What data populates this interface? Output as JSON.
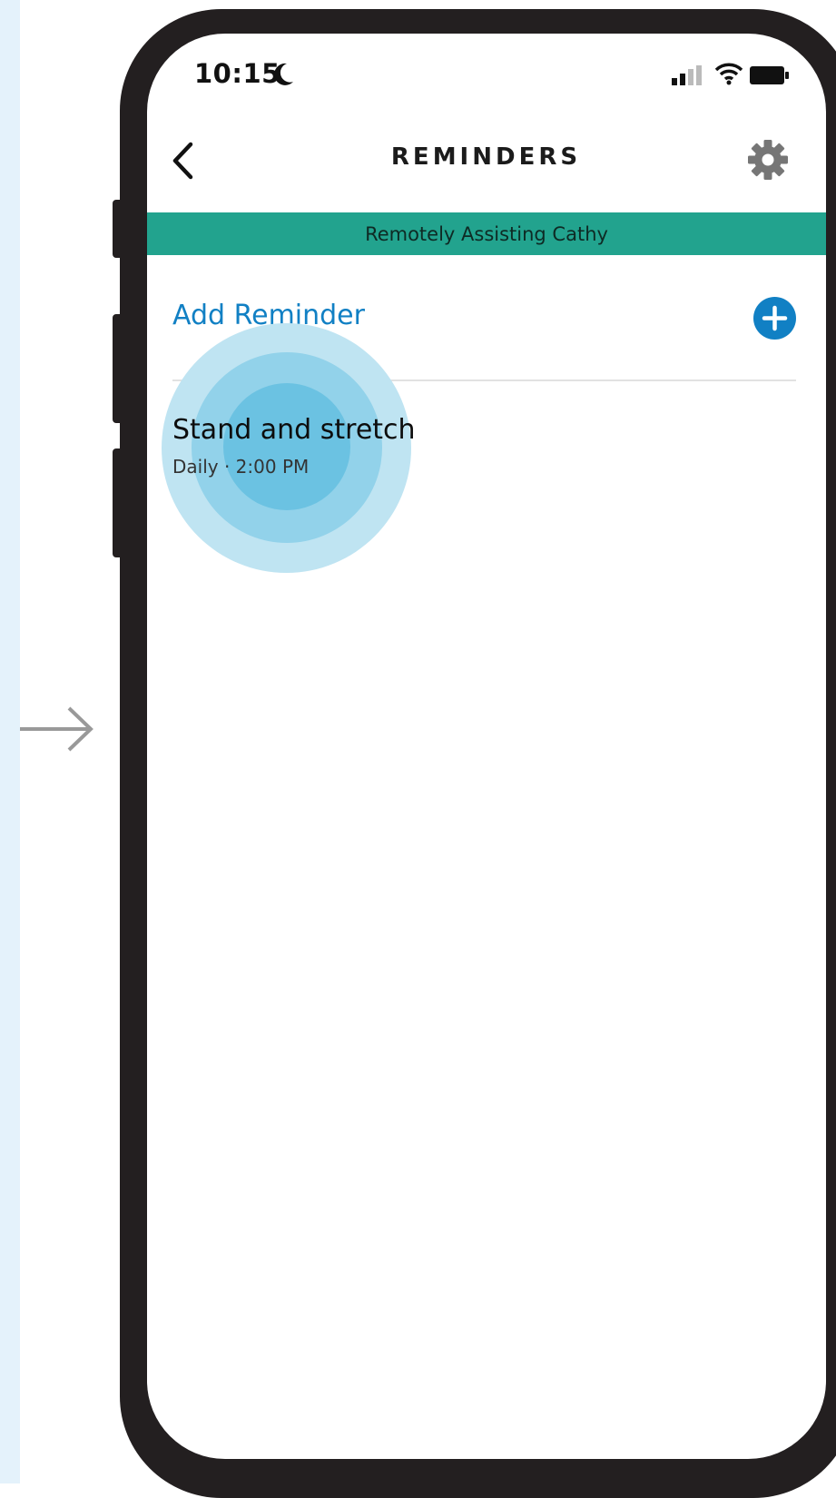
{
  "status_bar": {
    "time": "10:15",
    "icons": [
      "moon-icon",
      "signal-icon",
      "wifi-icon",
      "battery-icon"
    ]
  },
  "header": {
    "title": "REMINDERS",
    "back_icon": "chevron-left-icon",
    "settings_icon": "gear-icon"
  },
  "banner": {
    "text": "Remotely Assisting Cathy",
    "color": "#22a38e"
  },
  "add_reminder": {
    "label": "Add Reminder",
    "icon": "plus-circle-icon",
    "color": "#1180c4"
  },
  "reminders": [
    {
      "title": "Stand and stretch",
      "schedule": "Daily · 2:00 PM"
    }
  ],
  "annotation": {
    "tap_indicator_color": "#6bc2e2",
    "flow_arrow_icon": "arrow-right-icon"
  }
}
